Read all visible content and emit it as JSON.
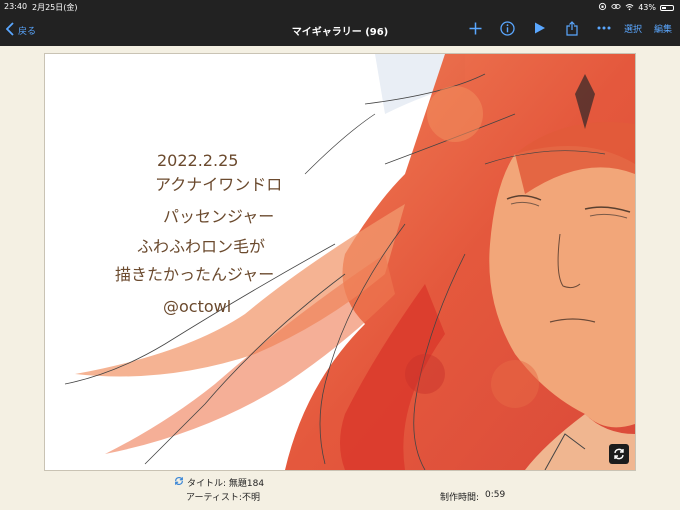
{
  "statusbar": {
    "time": "23:40",
    "date": "2月25日(金)",
    "battery": "43%",
    "battery_level": 0.43
  },
  "navbar": {
    "back_label": "戻る",
    "title": "マイギャラリー (96)",
    "select_label": "選択",
    "edit_label": "編集",
    "icons": [
      "plus-icon",
      "info-icon",
      "play-icon",
      "share-icon",
      "more-icon"
    ]
  },
  "artwork": {
    "caption_lines": [
      "2022.2.25",
      "アクナイワンドロ",
      "パッセンジャー",
      "ふわふわロン毛が",
      "描きたかったんジャー",
      "@octowl"
    ]
  },
  "info": {
    "title": "タイトル: 無題184",
    "artist": "アーティスト:不明",
    "time_label": "制作時間:",
    "time_value": "0:59"
  },
  "colors": {
    "bar": "#222222",
    "accent": "#5aa7ff",
    "background": "#f4f0e3",
    "hair": "#e8552f",
    "skin": "#f2a679"
  }
}
